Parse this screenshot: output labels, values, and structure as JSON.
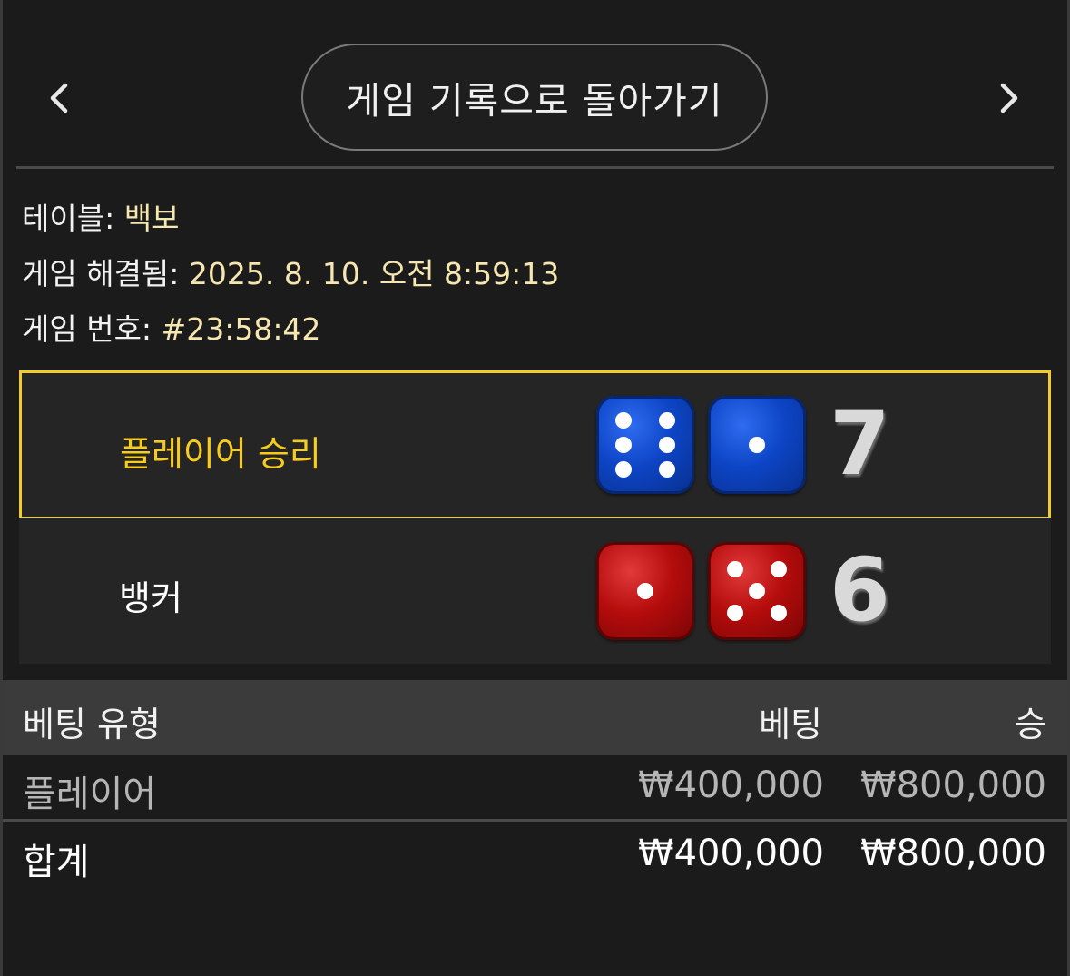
{
  "header": {
    "back_label": "게임 기록으로 돌아가기"
  },
  "info": {
    "table_label": "테이블:",
    "table_value": "백보",
    "resolved_label": "게임 해결됨:",
    "resolved_value": "2025. 8. 10. 오전 8:59:13",
    "game_label": "게임 번호:",
    "game_value": "#23:58:42"
  },
  "results": {
    "player": {
      "label": "플레이어 승리",
      "dice": [
        6,
        1
      ],
      "score": "7",
      "color": "#1448d0"
    },
    "banker": {
      "label": "뱅커",
      "dice": [
        1,
        5
      ],
      "score": "6",
      "color": "#b80e0e"
    },
    "winner_highlight": "#f2cc2a"
  },
  "bets": {
    "headers": {
      "type": "베팅 유형",
      "bet": "베팅",
      "win": "승"
    },
    "rows": [
      {
        "type": "플레이어",
        "bet": "₩400,000",
        "win": "₩800,000"
      }
    ],
    "total": {
      "type": "합계",
      "bet": "₩400,000",
      "win": "₩800,000"
    }
  },
  "icons": {
    "prev": "chevron-left-icon",
    "next": "chevron-right-icon"
  }
}
